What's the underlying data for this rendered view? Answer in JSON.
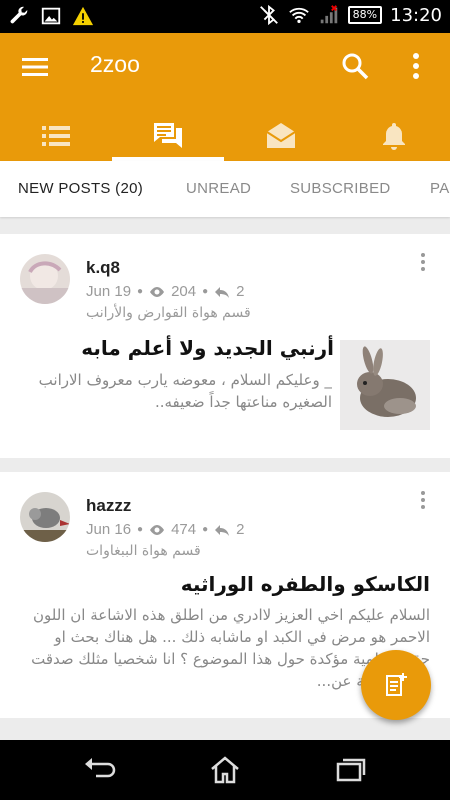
{
  "status_bar": {
    "icons_left": [
      "wrench-icon",
      "image-icon",
      "warning-icon"
    ],
    "icons_right": [
      "bluetooth-off-icon",
      "wifi-icon",
      "signal-icon"
    ],
    "battery": "88%",
    "time": "13:20"
  },
  "app_bar": {
    "title": "2zoo",
    "tab_icons": [
      "list-icon",
      "forum-icon",
      "mail-icon",
      "bell-icon"
    ],
    "active_tab_icon": 1
  },
  "tabs": [
    {
      "label": "NEW POSTS (20)",
      "active": true
    },
    {
      "label": "UNREAD",
      "active": false
    },
    {
      "label": "SUBSCRIBED",
      "active": false
    },
    {
      "label": "PA",
      "active": false
    }
  ],
  "posts": [
    {
      "username": "k.q8",
      "date": "Jun 19",
      "views": "204",
      "replies": "2",
      "forum": "قسم هواة القوارض والأرانب",
      "title": "أرنبي الجديد ولا أعلم مابه",
      "body": "_ وعليكم السلام ، معوضه يارب معروف الارانب الصغيره مناعتها جداً ضعيفه..",
      "has_thumb": true
    },
    {
      "username": "hazzz",
      "date": "Jun 16",
      "views": "474",
      "replies": "2",
      "forum": "قسم هواة الببغاوات",
      "title": "الكاسكو والطفره الوراثيه",
      "body": "السلام عليكم اخي العزيز لاادري من اطلق هذه الاشاعة ان اللون الاحمر هو مرض في الكبد او ماشابه ذلك ... هل هناك بحث او حقيقة علمية مؤكدة حول هذا الموضوع ؟ انا شخصيا مثلك صدقت هذه المقولة عن...",
      "has_thumb": false
    }
  ],
  "colors": {
    "accent": "#e99a0a",
    "tab_active": "#222222",
    "tab_inactive": "#8a8a8a"
  },
  "nav_bar": {
    "buttons": [
      "back-icon",
      "home-icon",
      "recents-icon"
    ]
  }
}
